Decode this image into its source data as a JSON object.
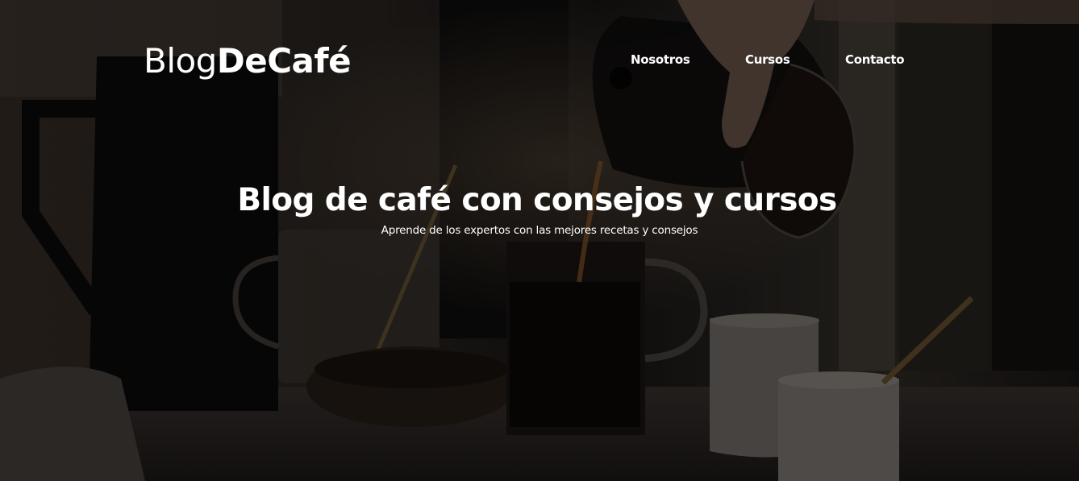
{
  "header": {
    "logo": {
      "light": "Blog",
      "bold": "DeCafé"
    },
    "nav": [
      {
        "label": "Nosotros"
      },
      {
        "label": "Cursos"
      },
      {
        "label": "Contacto"
      }
    ]
  },
  "hero": {
    "title": "Blog de café con consejos y cursos",
    "subtitle": "Aprende de los expertos con las mejores recetas y consejos",
    "background": "coffee-pouring-photo"
  },
  "colors": {
    "text": "#ffffff",
    "overlay": "#000000"
  }
}
